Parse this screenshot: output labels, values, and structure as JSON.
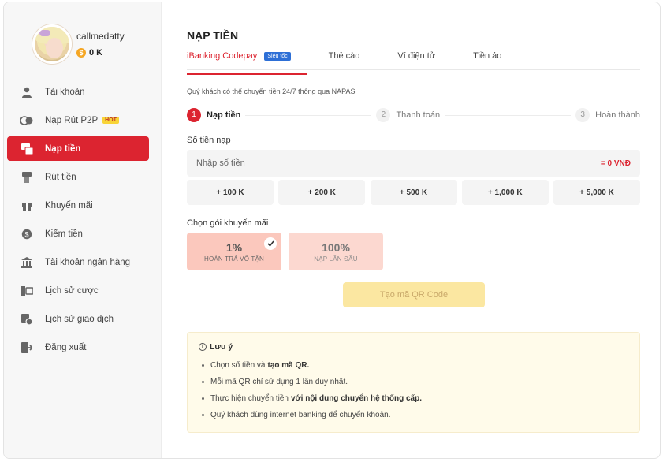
{
  "user": {
    "name": "callmedatty",
    "balance": "0 K",
    "coin_symbol": "$"
  },
  "sidebar": {
    "items": [
      {
        "label": "Tài khoản",
        "icon": "user-icon",
        "active": false
      },
      {
        "label": "Nạp Rút P2P",
        "icon": "p2p-icon",
        "badge": "HOT",
        "active": false
      },
      {
        "label": "Nạp tiền",
        "icon": "deposit-icon",
        "active": true
      },
      {
        "label": "Rút tiền",
        "icon": "withdraw-icon",
        "active": false
      },
      {
        "label": "Khuyến mãi",
        "icon": "gift-icon",
        "active": false
      },
      {
        "label": "Kiếm tiền",
        "icon": "earn-icon",
        "active": false
      },
      {
        "label": "Tài khoản ngân hàng",
        "icon": "bank-icon",
        "active": false
      },
      {
        "label": "Lịch sử cược",
        "icon": "bet-history-icon",
        "active": false
      },
      {
        "label": "Lịch sử giao dịch",
        "icon": "transaction-history-icon",
        "active": false
      },
      {
        "label": "Đăng xuất",
        "icon": "logout-icon",
        "active": false
      }
    ]
  },
  "main": {
    "title": "NẠP TIỀN",
    "tabs": [
      {
        "label": "iBanking Codepay",
        "badge": "Siêu tốc",
        "active": true
      },
      {
        "label": "Thẻ cào",
        "active": false
      },
      {
        "label": "Ví điện tử",
        "active": false
      },
      {
        "label": "Tiền ảo",
        "active": false
      }
    ],
    "notice": "Quý khách có thể chuyển tiền 24/7 thông qua NAPAS",
    "steps": [
      {
        "num": "1",
        "label": "Nạp tiền",
        "active": true
      },
      {
        "num": "2",
        "label": "Thanh toán",
        "active": false
      },
      {
        "num": "3",
        "label": "Hoàn thành",
        "active": false
      }
    ],
    "amount": {
      "label": "Số tiền nạp",
      "placeholder": "Nhập số tiền",
      "value": "",
      "total": "= 0 VNĐ"
    },
    "quick_amounts": [
      "+ 100 K",
      "+ 200 K",
      "+ 500 K",
      "+ 1,000 K",
      "+ 5,000 K"
    ],
    "promo": {
      "label": "Chọn gói khuyến mãi",
      "options": [
        {
          "value": "1%",
          "label": "HOÀN TRẢ VÔ TẬN",
          "selected": true
        },
        {
          "value": "100%",
          "label": "NẠP LẦN ĐẦU",
          "selected": false
        }
      ]
    },
    "qr_button": "Tạo mã QR Code",
    "note": {
      "title": "Lưu ý",
      "items": [
        {
          "text": "Chọn số tiền và",
          "bold": "tạo mã QR."
        },
        {
          "text": "Mỗi mã QR chỉ sử dụng 1 lần duy nhất.",
          "bold": ""
        },
        {
          "text": "Thực hiện chuyển tiền",
          "bold": "với nội dung chuyển hệ thống cấp."
        },
        {
          "text": "Quý khách dùng internet banking để chuyển khoản.",
          "bold": ""
        }
      ]
    }
  },
  "colors": {
    "accent": "#dc2430",
    "badge_blue": "#2d6fd6",
    "hot_yellow": "#f8d437",
    "qr_button_bg": "#fbe7a1",
    "note_bg": "#fffbea"
  }
}
